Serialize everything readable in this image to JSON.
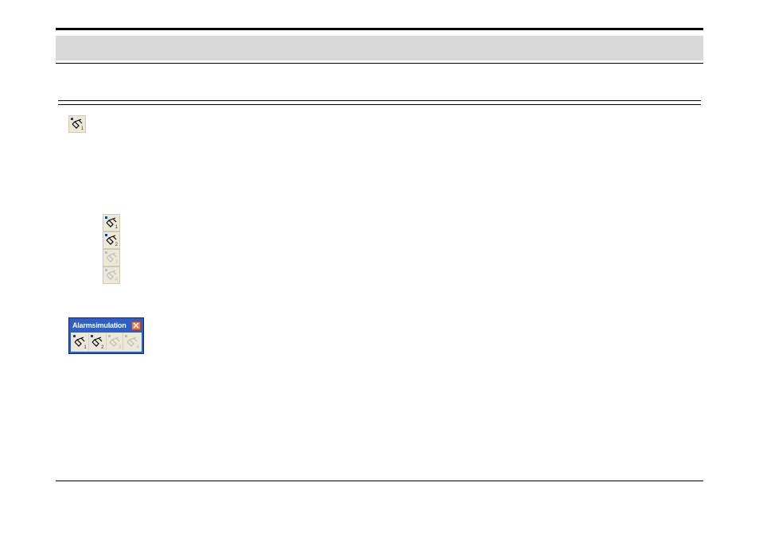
{
  "floatbar": {
    "title": "Alarmsimulation",
    "buttons": [
      {
        "num": "1",
        "enabled": true
      },
      {
        "num": "2",
        "enabled": true
      },
      {
        "num": "3",
        "enabled": false
      },
      {
        "num": "4",
        "enabled": false
      }
    ]
  },
  "stack": {
    "buttons": [
      {
        "num": "1",
        "enabled": true
      },
      {
        "num": "2",
        "enabled": true
      },
      {
        "num": "3",
        "enabled": false
      },
      {
        "num": "4",
        "enabled": false
      }
    ]
  },
  "standalone": {
    "num": "1",
    "enabled": true
  }
}
